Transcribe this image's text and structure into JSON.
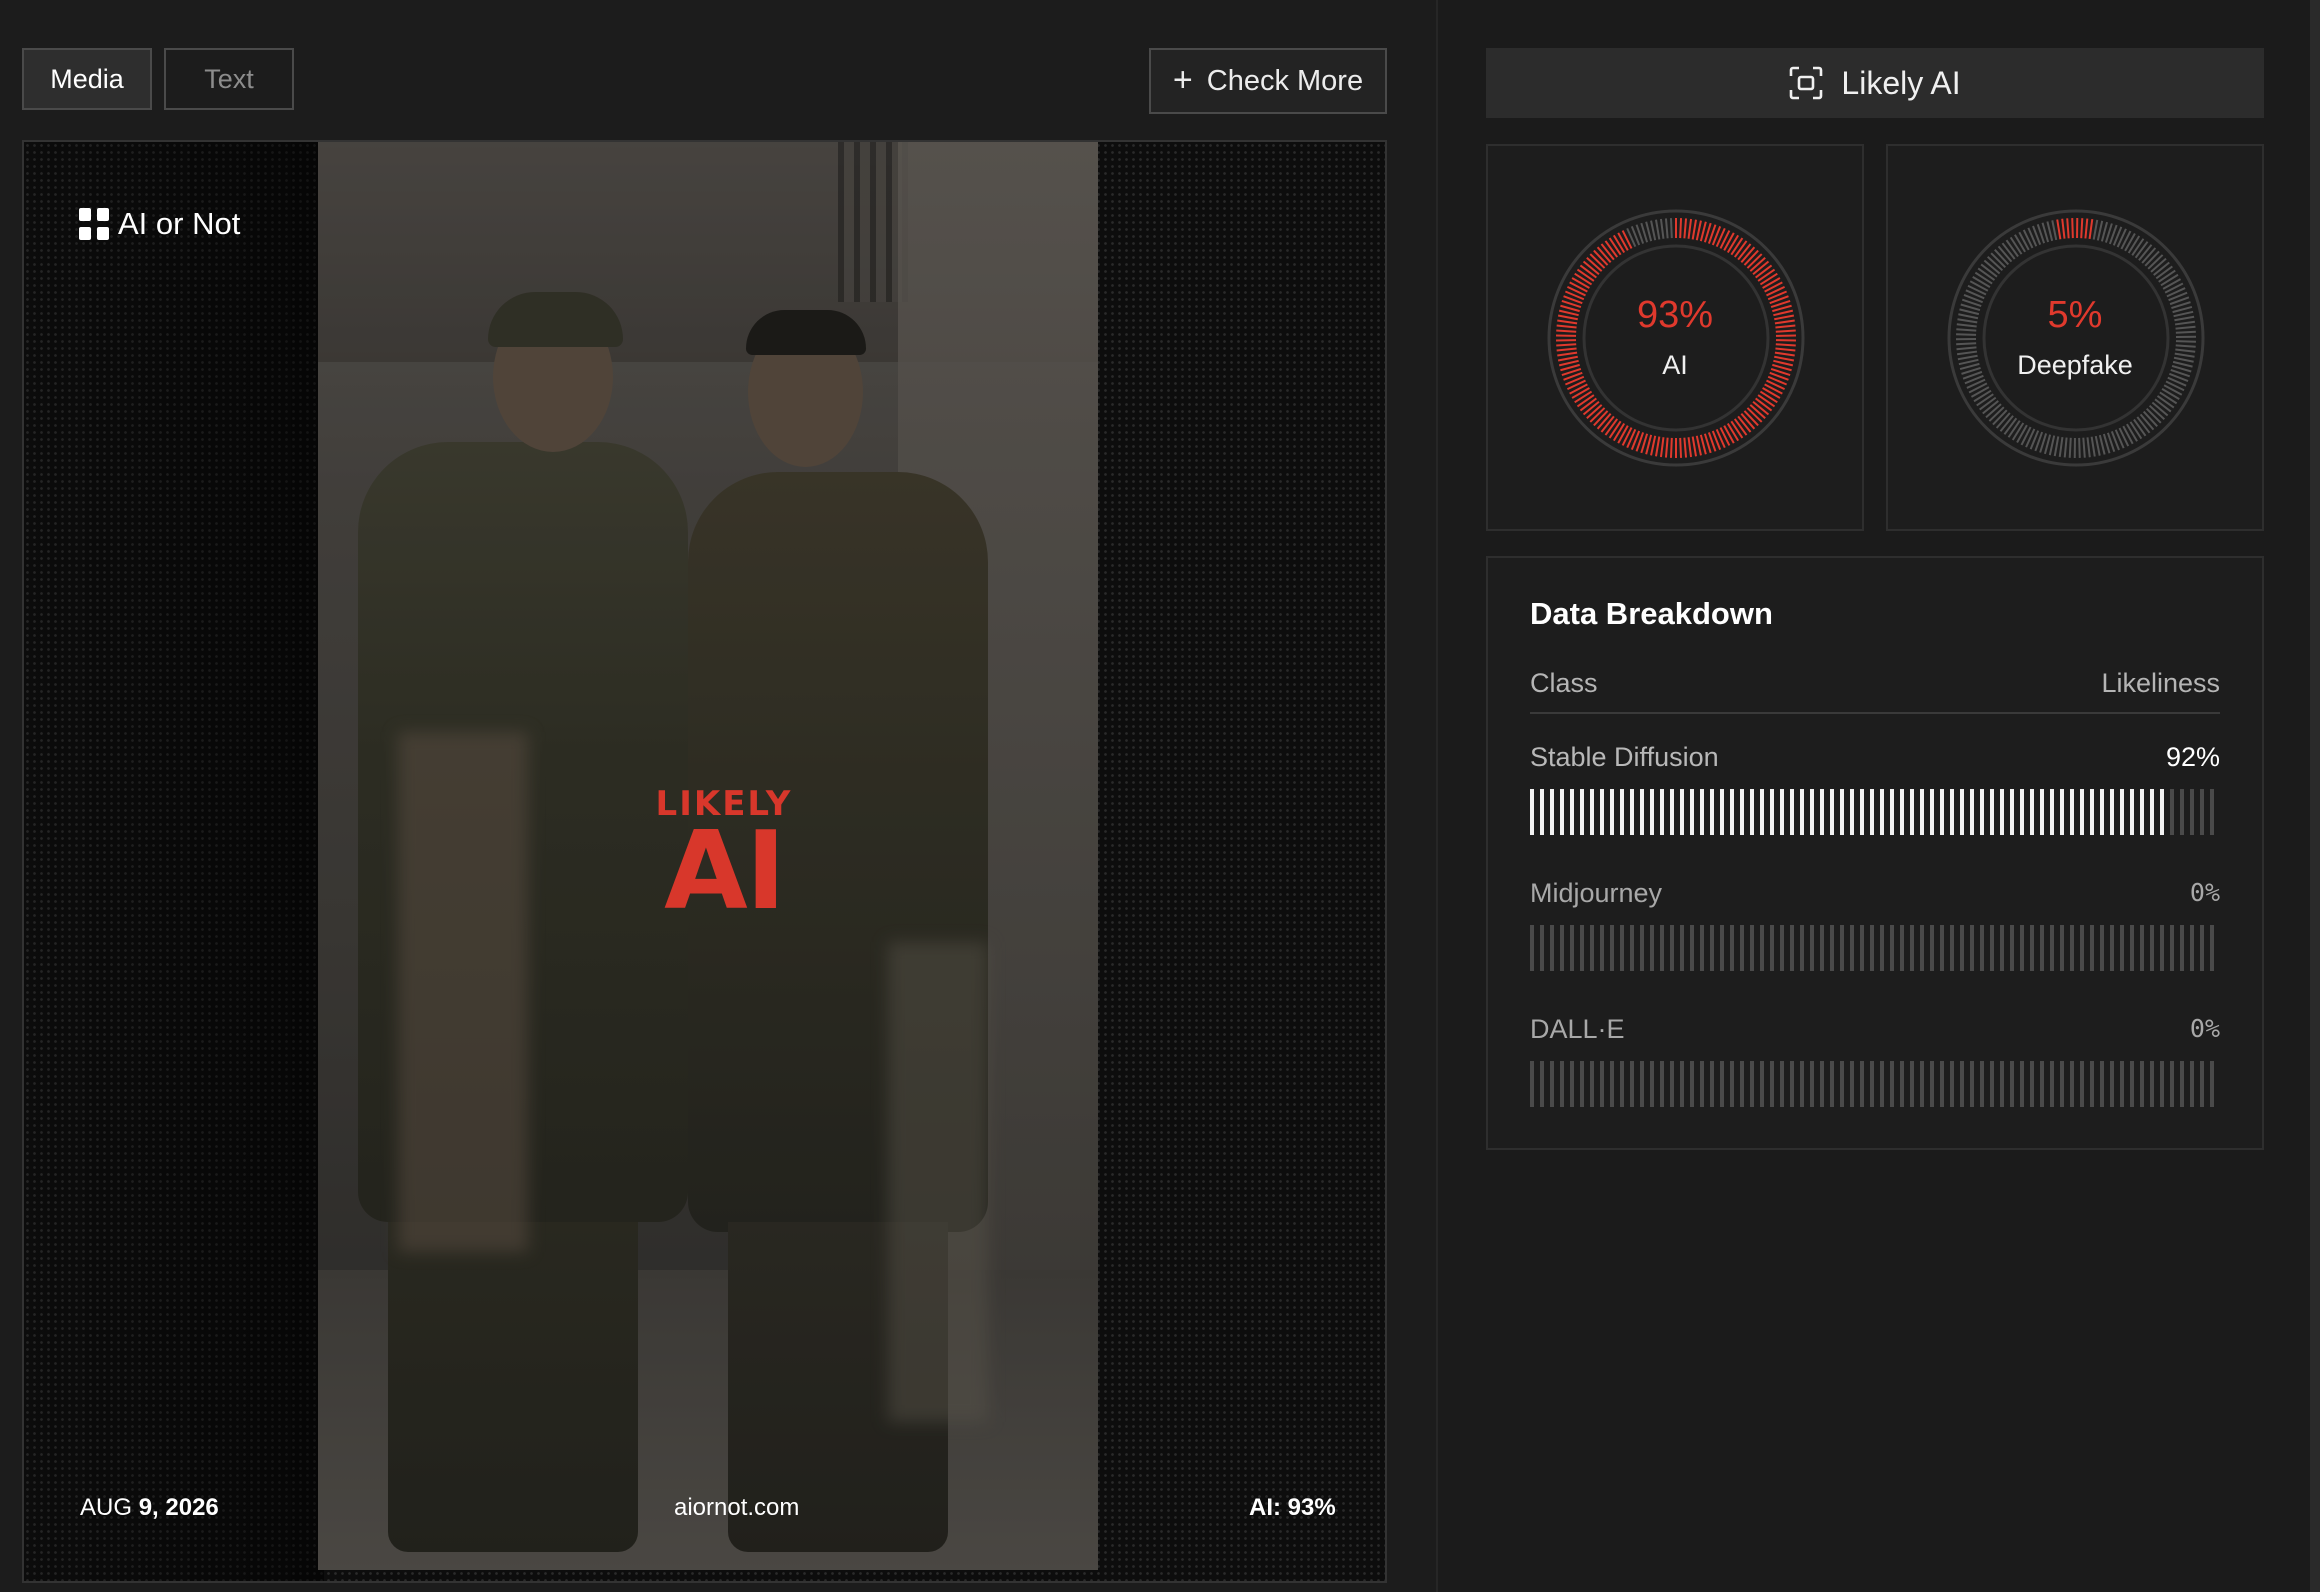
{
  "tabs": [
    {
      "label": "Media",
      "active": true
    },
    {
      "label": "Text",
      "active": false
    }
  ],
  "check_more_label": "Check More",
  "media": {
    "brand": "AI or Not",
    "stamp_small": "LIKELY",
    "stamp_big": "AI",
    "date_month": "AUG",
    "date_day_year": "9, 2026",
    "site": "aiornot.com",
    "score": "AI: 93%"
  },
  "verdict": {
    "label": "Likely AI",
    "icon": "scan-icon"
  },
  "gauges": [
    {
      "value_text": "93%",
      "label": "AI",
      "fraction": 0.93
    },
    {
      "value_text": "5%",
      "label": "Deepfake",
      "fraction": 0.05
    }
  ],
  "breakdown": {
    "title": "Data Breakdown",
    "col_class": "Class",
    "col_likeliness": "Likeliness",
    "rows": [
      {
        "name": "Stable Diffusion",
        "value_text": "92%",
        "fraction": 0.92
      },
      {
        "name": "Midjourney",
        "value_text": "0%",
        "fraction": 0.0
      },
      {
        "name": "DALL·E",
        "value_text": "0%",
        "fraction": 0.0
      }
    ]
  },
  "colors": {
    "accent_red": "#e0392d",
    "ring_grey": "#555555",
    "bar_fill": "#f2f2f2"
  }
}
